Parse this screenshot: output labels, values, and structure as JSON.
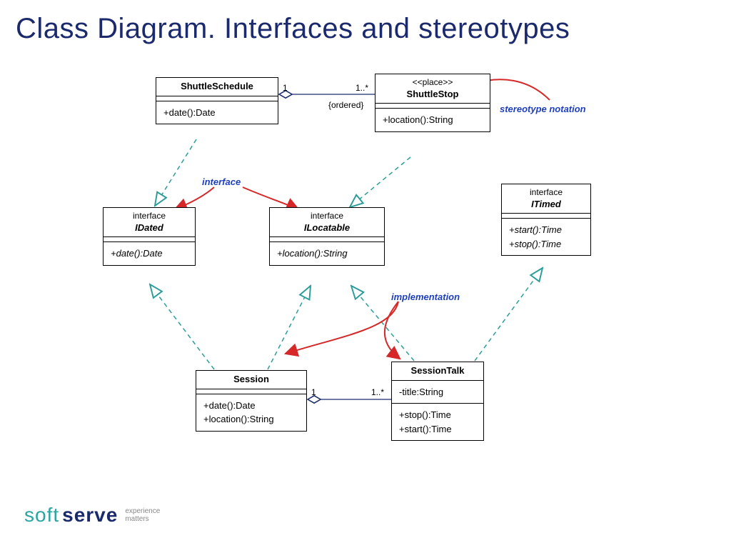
{
  "title": "Class Diagram. Interfaces and stereotypes",
  "shuttleSchedule": {
    "name": "ShuttleSchedule",
    "ops": "+date():Date"
  },
  "shuttleStop": {
    "stereo": "<<place>>",
    "name": "ShuttleStop",
    "ops": "+location():String"
  },
  "iDated": {
    "kw": "interface",
    "name": "IDated",
    "ops": "+date():Date"
  },
  "iLocatable": {
    "kw": "interface",
    "name": "ILocatable",
    "ops": "+location():String"
  },
  "iTimed": {
    "kw": "interface",
    "name": "ITimed",
    "op1": "+start():Time",
    "op2": "+stop():Time"
  },
  "session": {
    "name": "Session",
    "op1": "+date():Date",
    "op2": "+location():String"
  },
  "sessionTalk": {
    "name": "SessionTalk",
    "attr": "-title:String",
    "op1": "+stop():Time",
    "op2": "+start():Time"
  },
  "assoc": {
    "oneA": "1",
    "manyA": "1..*",
    "ordered": "{ordered}",
    "oneB": "1",
    "manyB": "1..*"
  },
  "notes": {
    "stereotype": "stereotype notation",
    "interface": "interface",
    "implementation": "implementation"
  },
  "logo": {
    "soft": "soft",
    "serve": "serve",
    "t1": "experience",
    "t2": "matters"
  }
}
